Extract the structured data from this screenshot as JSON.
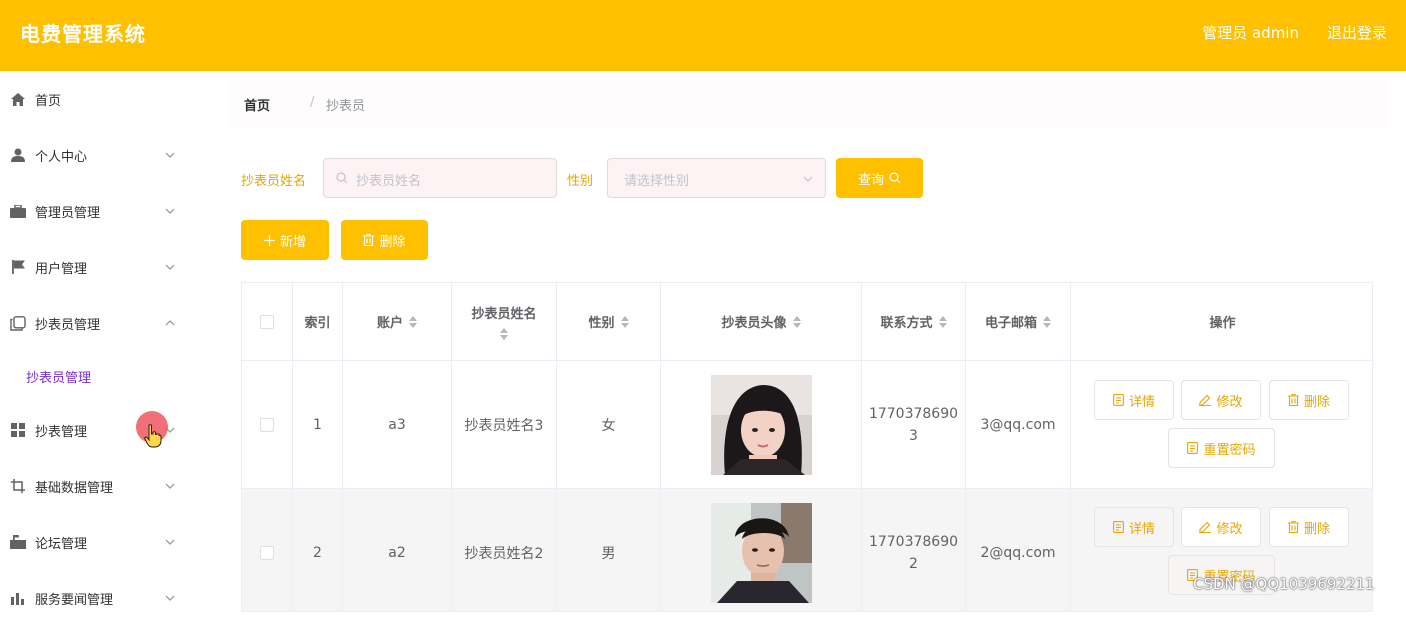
{
  "header": {
    "title": "电费管理系统",
    "user": "管理员 admin",
    "logout": "退出登录"
  },
  "sidebar": {
    "items": [
      {
        "label": "首页",
        "icon": "home-icon"
      },
      {
        "label": "个人中心",
        "icon": "user-icon"
      },
      {
        "label": "管理员管理",
        "icon": "briefcase-icon"
      },
      {
        "label": "用户管理",
        "icon": "flag-icon"
      },
      {
        "label": "抄表员管理",
        "icon": "copy-icon",
        "expanded": true
      },
      {
        "label": "抄表管理",
        "icon": "grid-icon"
      },
      {
        "label": "基础数据管理",
        "icon": "crop-icon"
      },
      {
        "label": "论坛管理",
        "icon": "mailbox-icon"
      },
      {
        "label": "服务要闻管理",
        "icon": "chart-icon"
      }
    ],
    "submenu_active": "抄表员管理"
  },
  "breadcrumb": {
    "home": "首页",
    "separator": "/",
    "current": "抄表员"
  },
  "search": {
    "name_label": "抄表员姓名",
    "name_placeholder": "抄表员姓名",
    "gender_label": "性别",
    "gender_placeholder": "请选择性别",
    "query_button": "查询"
  },
  "actions": {
    "add": "新增",
    "delete": "删除"
  },
  "table": {
    "headers": {
      "index": "索引",
      "account": "账户",
      "name": "抄表员姓名",
      "gender": "性别",
      "avatar": "抄表员头像",
      "phone": "联系方式",
      "email": "电子邮箱",
      "ops": "操作"
    },
    "row_buttons": {
      "detail": "详情",
      "edit": "修改",
      "delete": "删除",
      "reset": "重置密码"
    },
    "rows": [
      {
        "index": "1",
        "account": "a3",
        "name": "抄表员姓名3",
        "gender": "女",
        "phone_line1": "1770378690",
        "phone_line2": "3",
        "email": "3@qq.com"
      },
      {
        "index": "2",
        "account": "a2",
        "name": "抄表员姓名2",
        "gender": "男",
        "phone_line1": "1770378690",
        "phone_line2": "2",
        "email": "2@qq.com"
      }
    ]
  },
  "watermark": "CSDN @QQ1039692211",
  "colors": {
    "brand": "#ffc000",
    "accent_text": "#e6a700",
    "submenu_active": "#7b2fd0"
  }
}
